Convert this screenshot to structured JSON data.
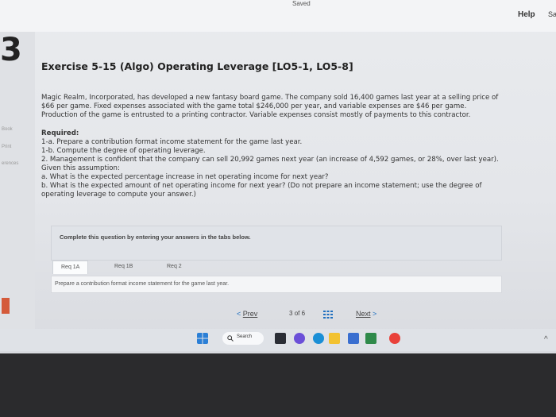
{
  "header": {
    "saved_status": "Saved",
    "help_label": "Help",
    "save_exit_truncated": "Sa"
  },
  "left_rail": {
    "question_number": "3",
    "items": [
      "Book",
      "Print",
      "erences"
    ]
  },
  "exercise": {
    "title": "Exercise 5-15 (Algo) Operating Leverage [LO5-1, LO5-8]",
    "intro_lines": [
      "Magic Realm, Incorporated, has developed a new fantasy board game. The company sold 16,400 games last year at a selling price of",
      "$66 per game. Fixed expenses associated with the game total $246,000 per year, and variable expenses are $46 per game.",
      "Production of the game is entrusted to a printing contractor. Variable expenses consist mostly of payments to this contractor."
    ],
    "required_label": "Required:",
    "required_lines": [
      "1-a. Prepare a contribution format income statement for the game last year.",
      "1-b. Compute the degree of operating leverage.",
      "2. Management is confident that the company can sell 20,992 games next year (an increase of 4,592 games, or 28%, over last year).",
      "Given this assumption:",
      "a. What is the expected percentage increase in net operating income for next year?",
      "b. What is the expected amount of net operating income for next year? (Do not prepare an income statement; use the degree of",
      "operating leverage to compute your answer.)"
    ]
  },
  "instructions": "Complete this question by entering your answers in the tabs below.",
  "tabs": [
    {
      "label": "Req 1A",
      "active": true
    },
    {
      "label": "Req 1B",
      "active": false
    },
    {
      "label": "Req 2",
      "active": false
    }
  ],
  "tab_prompt": "Prepare a contribution format income statement for the game last year.",
  "navigation": {
    "prev_label": "Prev",
    "page_current": "3",
    "page_sep": "of",
    "page_total": "6",
    "next_label": "Next"
  },
  "taskbar": {
    "search_label": "Search",
    "icons": [
      "windows-icon",
      "search-icon",
      "file-explorer-icon",
      "chat-icon",
      "edge-icon",
      "folder-icon",
      "store-icon",
      "chrome-icon"
    ]
  },
  "colors": {
    "accent_blue": "#1f6fbf",
    "prompt_highlight": "#d23c3c"
  }
}
